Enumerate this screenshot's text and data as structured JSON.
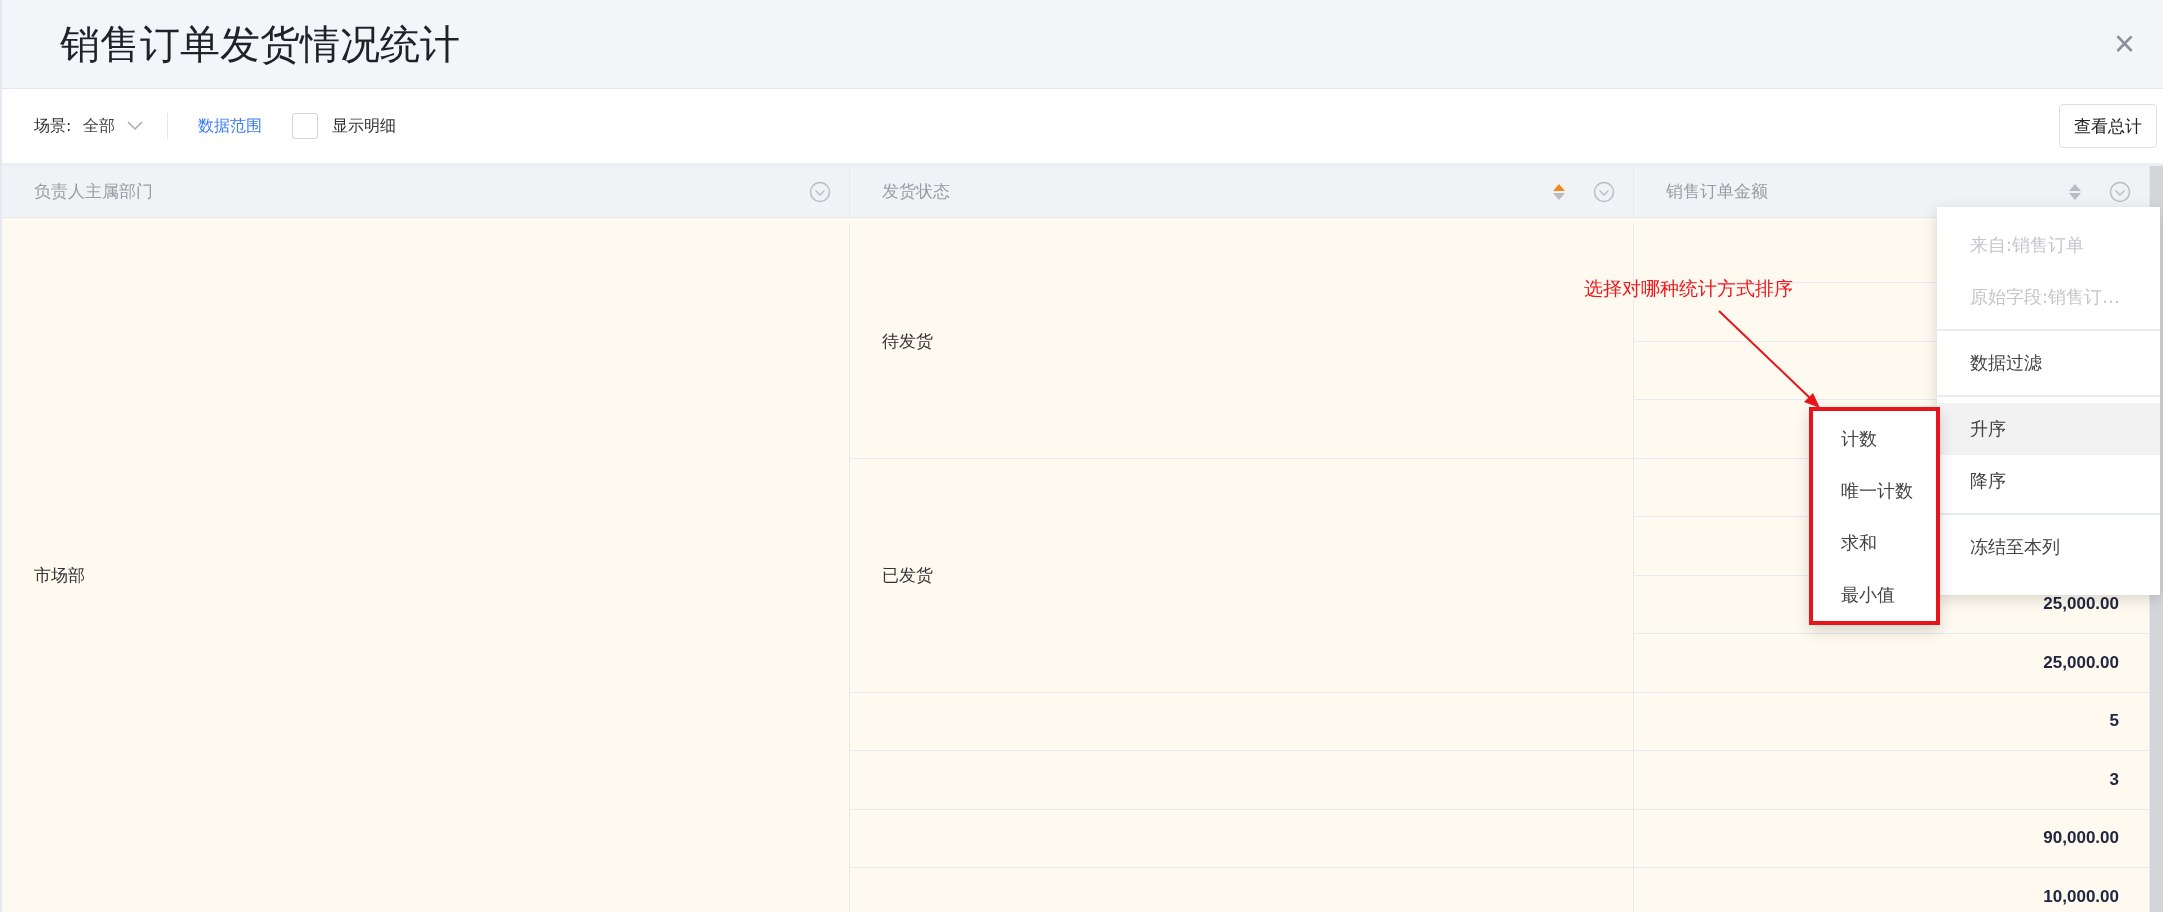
{
  "dialog": {
    "title": "销售订单发货情况统计",
    "close": "×"
  },
  "toolbar": {
    "scene_label": "场景:",
    "scene_value": "全部",
    "data_range": "数据范围",
    "show_detail": {
      "label": "显示明细",
      "checked": false
    },
    "totals_button": "查看总计"
  },
  "table": {
    "columns": [
      {
        "label": "负责人主属部门",
        "sortable": false
      },
      {
        "label": "发货状态",
        "sortable": true,
        "sorted_ascending": true
      },
      {
        "label": "销售订单金额",
        "sortable": true,
        "sorted_ascending": false
      }
    ],
    "department": "市场部",
    "groups": [
      {
        "status": "待发货",
        "rows": [
          {},
          {},
          {},
          {}
        ]
      },
      {
        "status": "已发货",
        "rows": [
          {},
          {},
          {
            "value": "25,000.00"
          },
          {
            "value": "25,000.00"
          }
        ]
      },
      {
        "rows": [
          {
            "value": "5"
          }
        ]
      },
      {
        "rows": [
          {
            "value": "3"
          }
        ]
      },
      {
        "rows": [
          {
            "value": "90,000.00"
          }
        ]
      },
      {
        "rows": [
          {
            "value": "10,000.00"
          }
        ]
      }
    ]
  },
  "column_menu": {
    "items": [
      {
        "kind": "info",
        "label": "来自:销售订单"
      },
      {
        "kind": "info",
        "label": "原始字段:销售订…"
      },
      {
        "kind": "divider"
      },
      {
        "kind": "action",
        "label": "数据过滤",
        "selected": false
      },
      {
        "kind": "divider"
      },
      {
        "kind": "action",
        "label": "升序",
        "selected": true
      },
      {
        "kind": "action",
        "label": "降序",
        "selected": false
      },
      {
        "kind": "divider"
      },
      {
        "kind": "action",
        "label": "冻结至本列",
        "selected": false
      }
    ]
  },
  "submenu": {
    "items": [
      {
        "label": "计数"
      },
      {
        "label": "唯一计数"
      },
      {
        "label": "求和"
      },
      {
        "label": "最小值"
      }
    ]
  },
  "annotation": {
    "text": "选择对哪种统计方式排序"
  }
}
